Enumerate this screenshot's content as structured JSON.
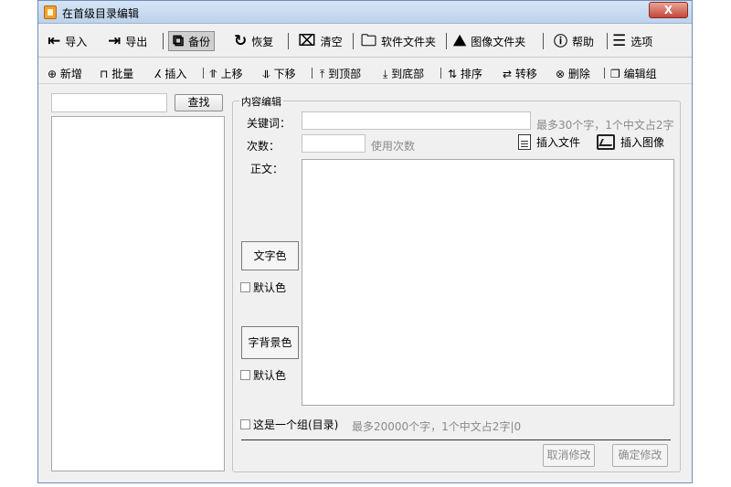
{
  "window": {
    "title": "在首级目录编辑",
    "close_glyph": "X"
  },
  "toolbar": {
    "import": "导入",
    "export": "导出",
    "backup": "备份",
    "restore": "恢复",
    "clear": "清空",
    "app_folder": "软件文件夹",
    "image_folder": "图像文件夹",
    "help": "帮助",
    "options": "选项"
  },
  "toolbar2": {
    "add": "新增",
    "batch": "批量",
    "insert": "插入",
    "move_up": "上移",
    "move_down": "下移",
    "to_top": "到顶部",
    "to_bottom": "到底部",
    "sort": "排序",
    "transfer": "转移",
    "delete": "删除",
    "edit_group": "编辑组"
  },
  "search": {
    "value": "",
    "button": "查找"
  },
  "editor": {
    "legend": "内容编辑",
    "keyword_label": "关键词：",
    "keyword_value": "",
    "keyword_hint": "最多30个字，1个中文占2字",
    "count_label": "次数：",
    "count_value": "",
    "count_hint": "使用次数",
    "insert_file": "插入文件",
    "insert_image": "插入图像",
    "body_label": "正文：",
    "text_color_btn": "文字色",
    "default_color_1": "默认色",
    "bg_color_btn": "字背景色",
    "default_color_2": "默认色",
    "is_group_label": "这是一个组(目录)",
    "body_hint": "最多20000个字，1个中文占2字|0",
    "cancel_btn": "取消修改",
    "confirm_btn": "确定修改"
  },
  "colors": {
    "titlebar": "#c5d9f0",
    "close": "#c6463a",
    "window_bg": "#f0f0f0"
  }
}
